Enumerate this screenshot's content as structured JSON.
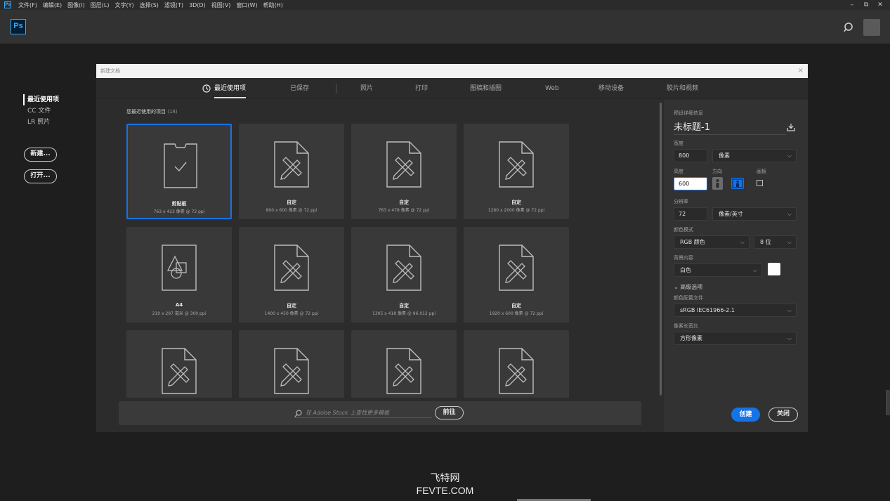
{
  "menubar": {
    "app_icon": "Ps",
    "items": [
      "文件(F)",
      "编辑(E)",
      "图像(I)",
      "图层(L)",
      "文字(Y)",
      "选择(S)",
      "滤镜(T)",
      "3D(D)",
      "视图(V)",
      "窗口(W)",
      "帮助(H)"
    ],
    "controls": [
      "–",
      "⧉",
      "✕"
    ]
  },
  "appbar": {
    "logo": "Ps"
  },
  "start_panel": {
    "nav": [
      "最近使用项",
      "CC 文件",
      "LR 照片"
    ],
    "new_button": "新建...",
    "open_button": "打开..."
  },
  "dialog": {
    "title": "新建文档",
    "close": "×",
    "tabs": [
      "最近使用项",
      "已保存",
      "照片",
      "打印",
      "图稿和插图",
      "Web",
      "移动设备",
      "胶片和视频"
    ],
    "recent_heading": "您最近使用的项目",
    "recent_count": "(18)",
    "tiles": [
      {
        "name": "剪贴板",
        "info": "763 x 423 像素 @ 72 ppi",
        "icon": "clipboard-icon",
        "selected": true
      },
      {
        "name": "自定",
        "info": "800 x 600 像素 @ 72 ppi",
        "icon": "custom-doc-icon"
      },
      {
        "name": "自定",
        "info": "763 x 478 像素 @ 72 ppi",
        "icon": "custom-doc-icon"
      },
      {
        "name": "自定",
        "info": "1280 x 2000 像素 @ 72 ppi",
        "icon": "custom-doc-icon"
      },
      {
        "name": "A4",
        "info": "210 x 297 毫米 @ 300 ppi",
        "icon": "shapes-doc-icon"
      },
      {
        "name": "自定",
        "info": "1400 x 450 像素 @ 72 ppi",
        "icon": "custom-doc-icon"
      },
      {
        "name": "自定",
        "info": "1305 x 418 像素 @ 96.012 ppi",
        "icon": "custom-doc-icon"
      },
      {
        "name": "自定",
        "info": "1920 x 600 像素 @ 72 ppi",
        "icon": "custom-doc-icon"
      },
      {
        "name": "",
        "info": "",
        "icon": "custom-doc-icon"
      },
      {
        "name": "",
        "info": "",
        "icon": "custom-doc-icon"
      },
      {
        "name": "",
        "info": "",
        "icon": "custom-doc-icon"
      },
      {
        "name": "",
        "info": "",
        "icon": "custom-doc-icon"
      }
    ],
    "stock_placeholder": "在 Adobe Stock 上查找更多模板",
    "goto_button": "前往"
  },
  "preset": {
    "section_label": "预设详细信息",
    "doc_name": "未标题-1",
    "width_label": "宽度",
    "width_value": "800",
    "width_unit": "像素",
    "height_label": "高度",
    "height_value": "600",
    "orientation_label": "方向",
    "artboard_label": "画板",
    "resolution_label": "分辨率",
    "resolution_value": "72",
    "resolution_unit": "像素/英寸",
    "color_mode_label": "颜色模式",
    "color_mode_value": "RGB 颜色",
    "bit_depth": "8 位",
    "background_label": "背景内容",
    "background_value": "白色",
    "advanced_label": "高级选项",
    "color_profile_label": "颜色配置文件",
    "color_profile_value": "sRGB IEC61966-2.1",
    "pixel_aspect_label": "像素长宽比",
    "pixel_aspect_value": "方形像素",
    "create_button": "创建",
    "close_button": "关闭"
  },
  "watermark": {
    "line1": "飞特网",
    "line2": "FEVTE.COM"
  },
  "colors": {
    "accent": "#1473e6",
    "ps_blue": "#31a8ff"
  }
}
